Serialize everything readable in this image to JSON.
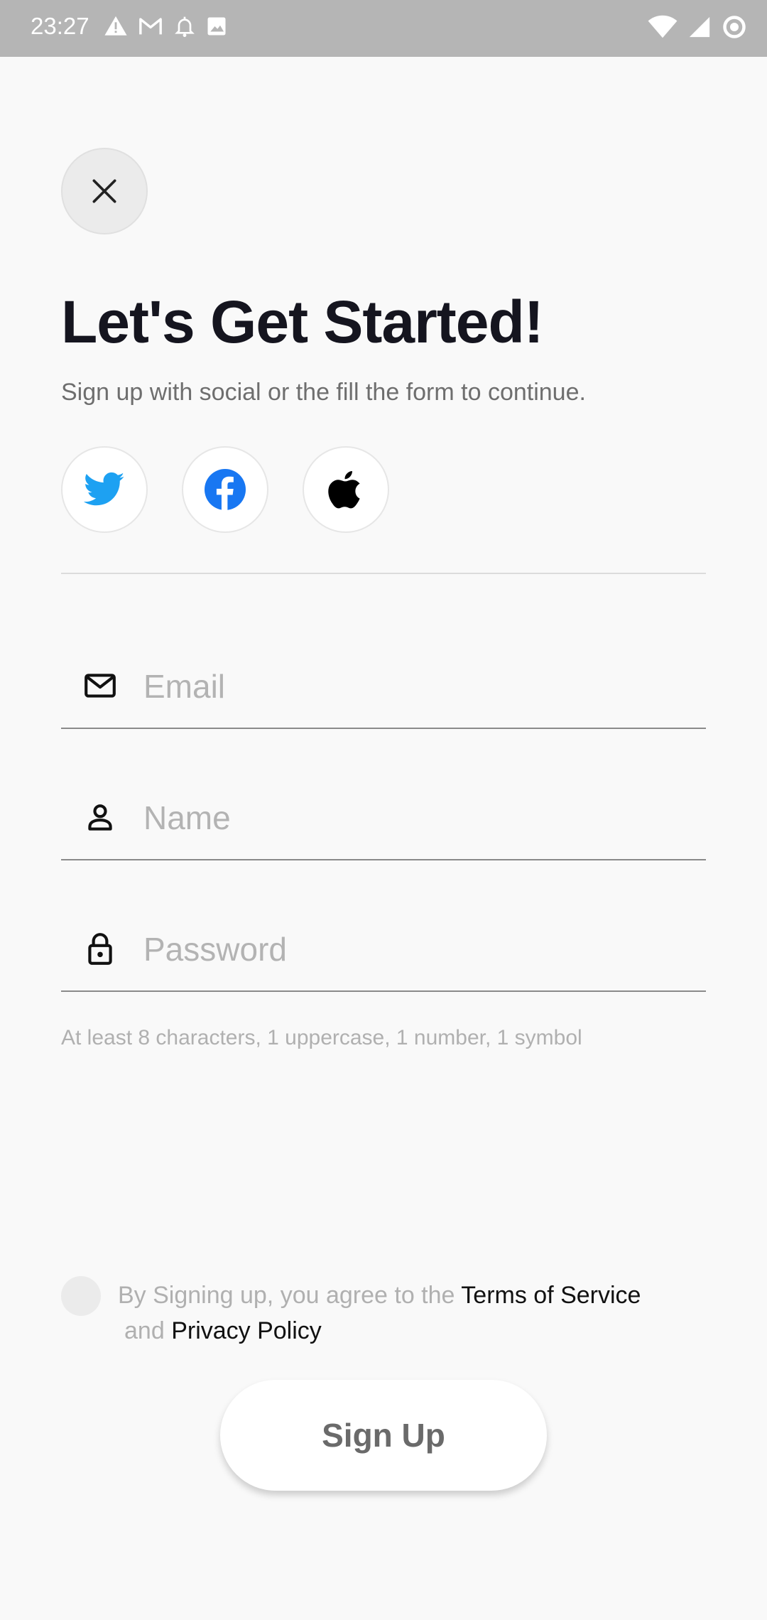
{
  "status_bar": {
    "time": "23:27",
    "left_icons": [
      "warning-icon",
      "gmail-icon",
      "notification-bell-icon",
      "image-icon"
    ],
    "right_icons": [
      "wifi-icon",
      "signal-icon",
      "sync-icon"
    ]
  },
  "header": {
    "close_icon": "close-icon",
    "title": "Let's Get Started!",
    "subtitle": "Sign up with social or the fill the form to continue."
  },
  "social": [
    {
      "name": "twitter",
      "icon": "twitter-icon",
      "color": "#1DA1F2"
    },
    {
      "name": "facebook",
      "icon": "facebook-icon",
      "color": "#1877F2"
    },
    {
      "name": "apple",
      "icon": "apple-icon",
      "color": "#000000"
    }
  ],
  "form": {
    "email": {
      "placeholder": "Email",
      "value": "",
      "icon": "mail-icon"
    },
    "name": {
      "placeholder": "Name",
      "value": "",
      "icon": "person-icon"
    },
    "password": {
      "placeholder": "Password",
      "value": "",
      "icon": "lock-icon"
    },
    "password_hint": "At least 8 characters, 1 uppercase, 1 number, 1 symbol"
  },
  "agreement": {
    "checked": false,
    "text_prefix": "By Signing up, you agree to the ",
    "terms_link": "Terms of Service",
    "text_and": "and ",
    "privacy_link": "Privacy Policy"
  },
  "actions": {
    "signup_label": "Sign Up"
  }
}
